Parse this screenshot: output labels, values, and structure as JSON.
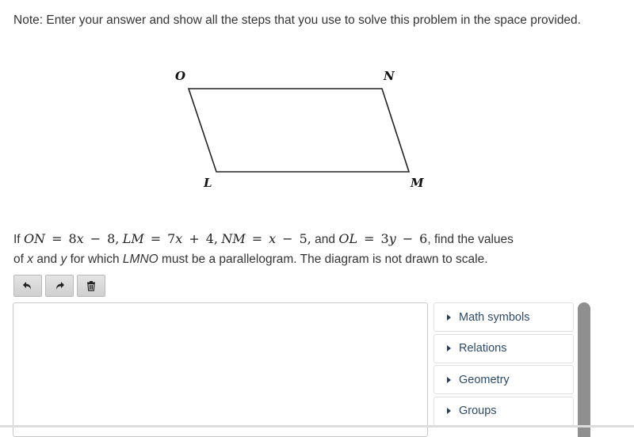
{
  "note": "Note: Enter your answer and show all the steps that you use to solve this problem in the space provided.",
  "diagram": {
    "vertices": {
      "O": "O",
      "N": "N",
      "L": "L",
      "M": "M"
    }
  },
  "problem": {
    "if": "If",
    "eq1": {
      "lhs": "ON",
      "rhs_a": "8",
      "rhs_var": "x",
      "op": "−",
      "rhs_b": "8"
    },
    "eq2": {
      "lhs": "LM",
      "rhs_a": "7",
      "rhs_var": "x",
      "op": "+",
      "rhs_b": "4"
    },
    "eq3": {
      "lhs": "NM",
      "rhs_a": "",
      "rhs_var": "x",
      "op": "−",
      "rhs_b": "5"
    },
    "eq4": {
      "lhs": "OL",
      "rhs_a": "3",
      "rhs_var": "y",
      "op": "−",
      "rhs_b": "6"
    },
    "and": "and",
    "find": "find the values",
    "line2_of": "of",
    "x": "x",
    "and2": "and",
    "y": "y",
    "for_which": "for which",
    "shape": "LMNO",
    "tail": "must be a parallelogram. The diagram is not drawn to scale.",
    "equals": "=",
    "comma": ","
  },
  "toolbar": {
    "undo": "undo-icon",
    "redo": "redo-icon",
    "delete": "trash-icon"
  },
  "editor": {
    "value": ""
  },
  "palette": {
    "items": [
      {
        "label": "Math symbols"
      },
      {
        "label": "Relations"
      },
      {
        "label": "Geometry"
      },
      {
        "label": "Groups"
      }
    ]
  }
}
